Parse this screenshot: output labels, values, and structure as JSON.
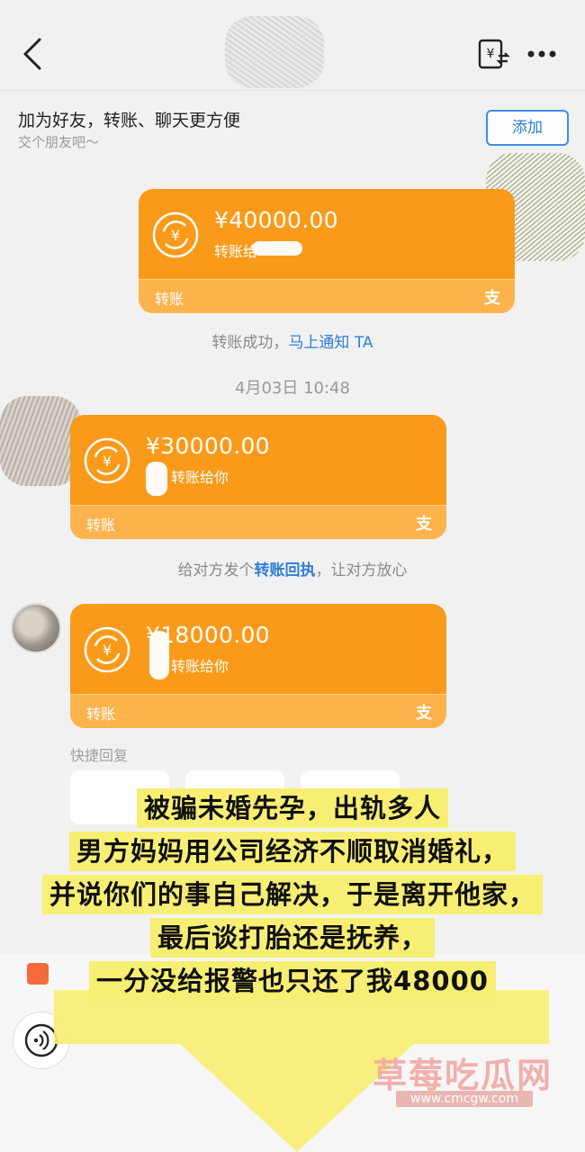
{
  "friend_banner": {
    "title": "加为好友，转账、聊天更方便",
    "subtitle": "交个朋友吧～",
    "add_label": "添加"
  },
  "transfers": [
    {
      "amount": "¥40000.00",
      "memo": "转账给",
      "footer_label": "转账",
      "footer_logo": "支"
    },
    {
      "amount": "¥30000.00",
      "memo": "转账给你",
      "footer_label": "转账",
      "footer_logo": "支"
    },
    {
      "amount": "¥18000.00",
      "memo": "转账给你",
      "footer_label": "转账",
      "footer_logo": "支"
    }
  ],
  "notes": {
    "success_text": "转账成功，",
    "success_link": "马上通知 TA",
    "timestamp": "4月03日 10:48",
    "receipt_pre": "给对方发个",
    "receipt_link": "转账回执",
    "receipt_post": "，让对方放心"
  },
  "quick_reply": {
    "label": "快捷回复"
  },
  "caption": {
    "lines": [
      "被骗未婚先孕，出轨多人",
      "男方妈妈用公司经济不顺取消婚礼，",
      "并说你们的事自己解决，于是离开他家，",
      "最后谈打胎还是抚养，",
      "一分没给报警也只还了我48000"
    ]
  },
  "watermark": {
    "name": "草莓吃瓜网",
    "url": "www.cmcgw.com"
  },
  "colors": {
    "card": "#fa9a1a",
    "card_footer": "#fcb34c",
    "link": "#2f7fd8",
    "caption_bg": "#f7ee74"
  },
  "icons": [
    "back-arrow-icon",
    "bill-exchange-icon",
    "more-dots-icon",
    "transfer-coin-icon",
    "alipay-icon",
    "voice-icon",
    "red-packet-icon"
  ]
}
